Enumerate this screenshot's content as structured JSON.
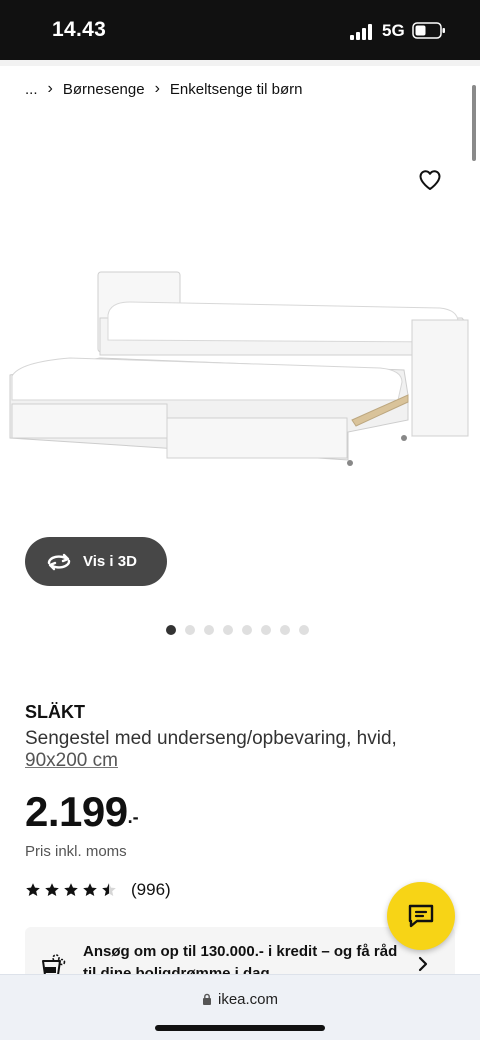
{
  "status": {
    "time": "14.43",
    "network": "5G"
  },
  "breadcrumb": {
    "items": [
      "...",
      "Børnesenge",
      "Enkeltsenge til børn"
    ]
  },
  "gallery": {
    "view3d_label": "Vis i 3D",
    "dot_count": 8,
    "active_index": 0
  },
  "product": {
    "name": "SLÄKT",
    "description": "Sengestel med underseng/opbevaring, hvid,",
    "size": "90x200 cm",
    "price_main": "2.199",
    "price_suffix": ".-",
    "price_note": "Pris inkl. moms",
    "rating": 4.5,
    "rating_count": "(996)"
  },
  "credit_banner": {
    "text": "Ansøg om op til 130.000.- i kredit – og få råd til dine boligdrømme i dag"
  },
  "browser": {
    "url": "ikea.com"
  },
  "colors": {
    "chat_button": "#f7d416",
    "active_dot": "#333333",
    "view3d_bg": "#474747"
  },
  "icons": [
    "signal-icon",
    "battery-icon",
    "chevron-right-icon",
    "heart-icon",
    "rotate-3d-icon",
    "star-icon",
    "chat-icon",
    "credit-icon",
    "lock-icon"
  ]
}
